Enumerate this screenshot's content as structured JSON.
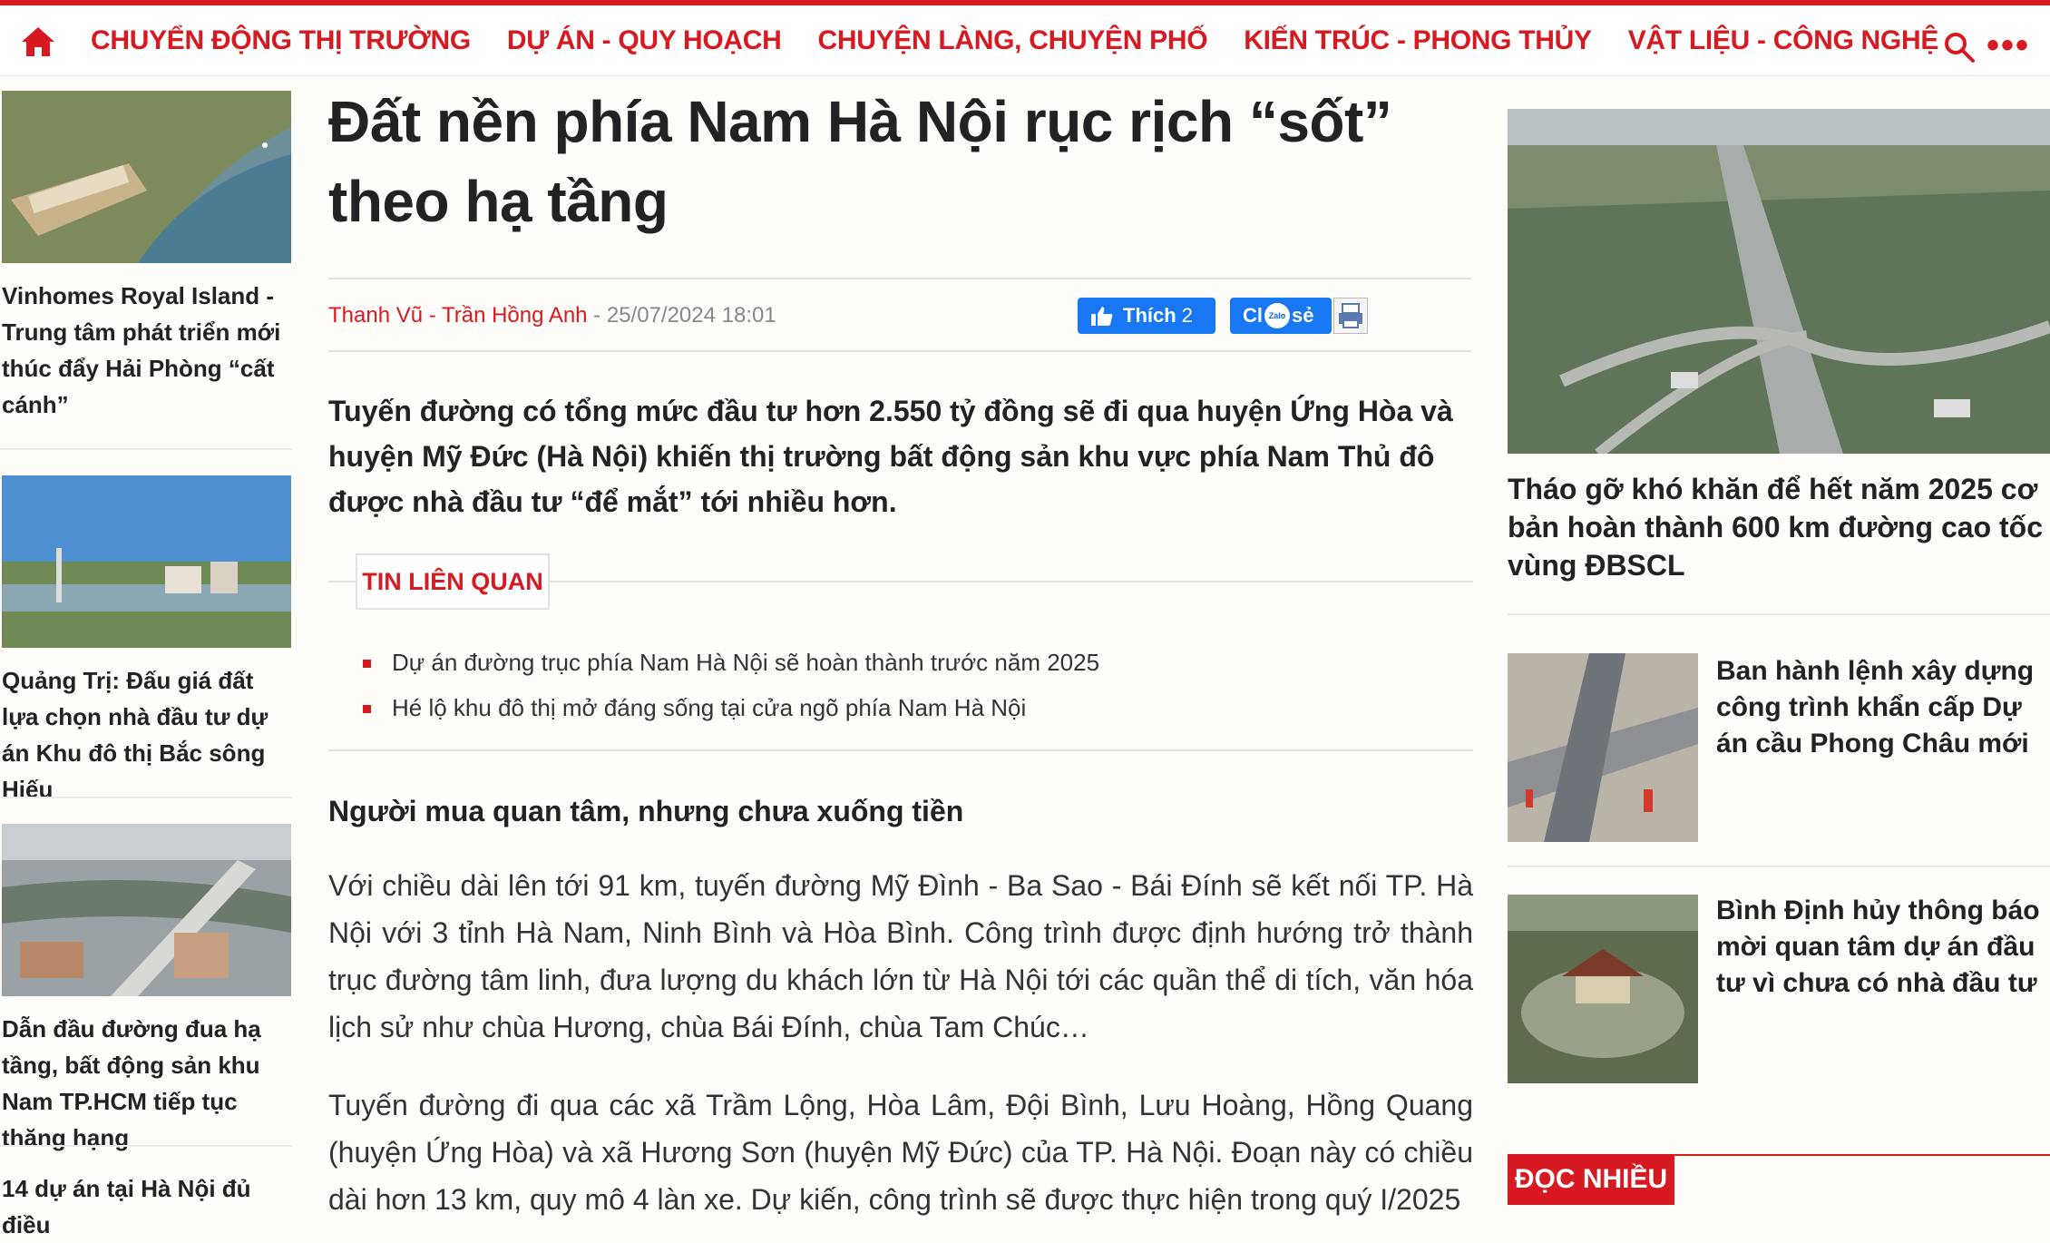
{
  "nav": {
    "items": [
      "CHUYỂN ĐỘNG THỊ TRƯỜNG",
      "DỰ ÁN - QUY HOẠCH",
      "CHUYỆN LÀNG, CHUYỆN PHỐ",
      "KIẾN TRÚC - PHONG THỦY",
      "VẬT LIỆU - CÔNG NGHỆ"
    ],
    "more": "•••"
  },
  "left": {
    "cards": [
      "Vinhomes Royal Island - Trung tâm phát triển mới thúc đẩy Hải Phòng “cất cánh”",
      "Quảng Trị: Đấu giá đất lựa chọn nhà đầu tư dự án Khu đô thị Bắc sông Hiếu",
      "Dẫn đầu đường đua hạ tầng, bất động sản khu Nam TP.HCM tiếp tục thăng hạng",
      "14 dự án tại Hà Nội đủ điều"
    ]
  },
  "article": {
    "headline": "Đất nền phía Nam Hà Nội rục rịch “sốt” theo hạ tầng",
    "author": "Thanh Vũ - Trần Hồng Anh",
    "date": " - 25/07/2024 18:01",
    "like_label": "Thích",
    "like_count": "2",
    "share_pre": "Cl",
    "share_zalo": "Zalo",
    "share_post": "sẻ",
    "lead": "Tuyến đường có tổng mức đầu tư hơn 2.550 tỷ đồng sẽ đi qua huyện Ứng Hòa và huyện Mỹ Đức (Hà Nội) khiến thị trường bất động sản khu vực phía Nam Thủ đô được nhà đầu tư “để mắt” tới nhiều hơn.",
    "related_title": "TIN LIÊN QUAN",
    "related": [
      "Dự án đường trục phía Nam Hà Nội sẽ hoàn thành trước năm 2025",
      "Hé lộ khu đô thị mở đáng sống tại cửa ngõ phía Nam Hà Nội"
    ],
    "subhead": "Người mua quan tâm, nhưng chưa xuống tiền",
    "para1": "Với chiều dài lên tới 91 km, tuyến đường Mỹ Đình - Ba Sao - Bái Đính sẽ kết nối TP. Hà Nội với 3 tỉnh Hà Nam, Ninh Bình và Hòa Bình. Công trình được định hướng trở thành trục đường tâm linh, đưa lượng du khách lớn từ Hà Nội tới các quần thể di tích, văn hóa lịch sử như chùa Hương, chùa Bái Đính, chùa Tam Chúc…",
    "para2": "Tuyến đường đi qua các xã Trầm Lộng, Hòa Lâm, Đội Bình, Lưu Hoàng, Hồng Quang (huyện Ứng Hòa) và xã Hương Sơn (huyện Mỹ Đức) của TP. Hà Nội. Đoạn này có chiều dài hơn 13 km, quy mô 4 làn xe. Dự kiến, công trình sẽ được thực hiện trong quý I/2025"
  },
  "right": {
    "big_title": "Tháo gỡ khó khăn để hết năm 2025 cơ bản hoàn thành 600 km đường cao tốc vùng ĐBSCL",
    "items": [
      "Ban hành lệnh xây dựng công trình khẩn cấp Dự án cầu Phong Châu mới",
      "Bình Định hủy thông báo mời quan tâm dự án đầu tư vì chưa có nhà đầu tư"
    ],
    "doc_nhieu": "ĐỌC NHIỀU"
  },
  "colors": {
    "brand": "#d71921",
    "facebook": "#1877f2"
  }
}
